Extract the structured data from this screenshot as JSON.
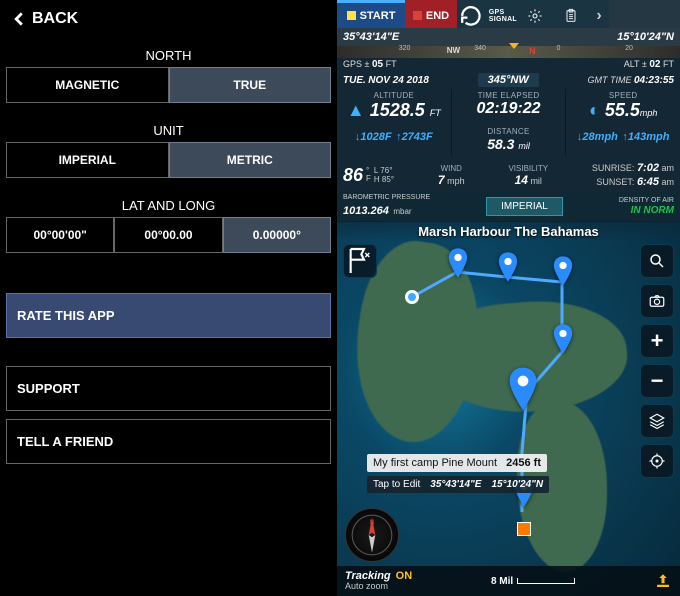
{
  "left": {
    "back": "BACK",
    "sections": {
      "north": {
        "label": "NORTH",
        "options": [
          "MAGNETIC",
          "TRUE"
        ],
        "selected": 1
      },
      "unit": {
        "label": "UNIT",
        "options": [
          "IMPERIAL",
          "METRIC"
        ],
        "selected": 1
      },
      "latlong": {
        "label": "LAT AND LONG",
        "options": [
          "00°00'00\"",
          "00°00.00",
          "0.00000°"
        ],
        "selected": 2
      }
    },
    "rows": {
      "rate": "RATE THIS APP",
      "support": "SUPPORT",
      "tell": "TELL A FRIEND"
    }
  },
  "right": {
    "topbar": {
      "start": "START",
      "end": "END",
      "gps": "GPS",
      "signal": "SIGNAL"
    },
    "coords": {
      "lat": "35°43'14\"E",
      "lon": "15°10'24\"N"
    },
    "ruler": {
      "t1": "320",
      "t2": "340",
      "t3": "0",
      "t4": "20",
      "nw": "NW",
      "n": "N"
    },
    "alt_gps": {
      "gps": "GPS ±",
      "gps_v": "05",
      "gps_u": "FT",
      "alt": "ALT ±",
      "alt_v": "02",
      "alt_u": "FT"
    },
    "dates": {
      "day": "TUE.",
      "date": "NOV 24 2018",
      "bearing": "345°NW",
      "gmt_l": "GMT TIME",
      "gmt_v": "04:23:55"
    },
    "altitude": {
      "label": "ALTITUDE",
      "value": "1528.5",
      "unit": "FT"
    },
    "elapsed": {
      "label": "TIME ELAPSED",
      "value": "02:19:22"
    },
    "speed": {
      "label": "SPEED",
      "value": "55.5",
      "unit": "mph"
    },
    "minmax": {
      "alt_down": "1028F",
      "alt_up": "2743F",
      "dist_l": "DISTANCE",
      "dist_v": "58.3",
      "dist_u": "mil",
      "spd_down": "28mph",
      "spd_up": "143mph"
    },
    "temp": {
      "value": "86",
      "unit": "°\nF",
      "L": "L 76°",
      "H": "H 85°"
    },
    "wind": {
      "label": "WIND",
      "value": "7",
      "unit": "mph"
    },
    "vis": {
      "label": "VISIBILITY",
      "value": "14",
      "unit": "mil"
    },
    "sun": {
      "sr_l": "SUNRISE:",
      "sr_v": "7:02",
      "sr_u": "am",
      "ss_l": "SUNSET:",
      "ss_v": "6:45",
      "ss_u": "am"
    },
    "press": {
      "label": "BAROMETRIC PRESSURE",
      "value": "1013.264",
      "unit": "mbar",
      "imp": "IMPERIAL",
      "dens_l": "DENSITY OF AIR",
      "dens_v": "IN NORM"
    },
    "map": {
      "title": "Marsh Harbour The Bahamas",
      "waypoint": "My first camp Pine Mount",
      "wp_alt": "2456 ft",
      "tap": "Tap to Edit",
      "tap_lat": "35°43'14\"E",
      "tap_lon": "15°10'24\"N",
      "tracking_l": "Tracking",
      "tracking_sub": "Auto zoom",
      "tracking_state": "ON",
      "scale": "8 Mil"
    }
  }
}
